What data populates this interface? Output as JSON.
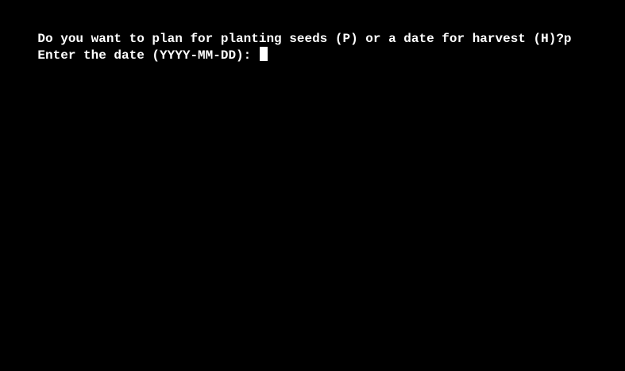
{
  "terminal": {
    "lines": [
      "Do you want to plan for planting seeds (P) or a date for harvest (H)?p",
      "Enter the date (YYYY-MM-DD): "
    ],
    "colors": {
      "background": "#000000",
      "text": "#ffffff",
      "cursor": "#ffffff"
    }
  }
}
